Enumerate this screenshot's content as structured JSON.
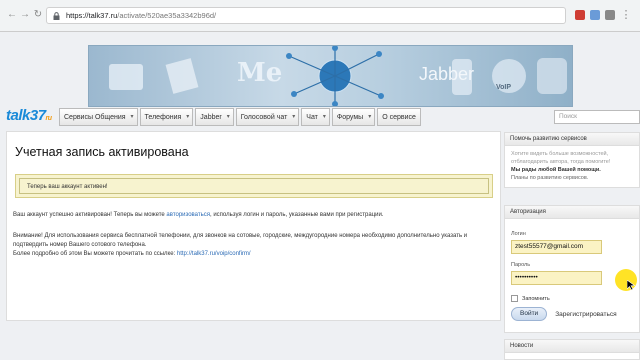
{
  "browser": {
    "url_host": "https://talk37.ru",
    "url_path": "/activate/520ae35a3342b96d/"
  },
  "logo": {
    "main": "talk37",
    "suffix": "ru"
  },
  "banner": {
    "jabber": "Jabber",
    "voip": "VoIP"
  },
  "menu": {
    "items": [
      "Сервисы Общения",
      "Телефония",
      "Jabber",
      "Голосовой чат",
      "Чат",
      "Форумы",
      "О сервисе"
    ]
  },
  "search": {
    "placeholder": "Поиск"
  },
  "main": {
    "title": "Учетная запись активирована",
    "notice": "Теперь ваш аккаунт активен!",
    "line1_pre": "Ваш аккаунт успешно активирован! Теперь вы можете ",
    "line1_link": "авторизоваться",
    "line1_post": ", используя логин и пароль, указанные вами при регистрации.",
    "warning": "Внимание! Для использования сервиса бесплатной телефонии, для звонков на сотовые, городские, междугородние номера необходимо дополнительно указать и подтвердить номер Вашего сотового телефона.",
    "more_pre": "Более подробно об этом Вы можете прочитать по ссылке: ",
    "more_link": "http://talk37.ru/voip/confirm/"
  },
  "help": {
    "header": "Помочь развитию сервисов",
    "text": "Хотите видеть больше возможностей, отблагодарить автора, тогда помогите!",
    "thanks": "Мы рады любой Вашей помощи.",
    "plans": "Планы по развитию сервисов."
  },
  "auth": {
    "header": "Авторизация",
    "login_label": "Логин",
    "login_value": "ztest55577@gmail.com",
    "password_label": "Пароль",
    "password_value": "••••••••••",
    "remember": "Запомнить",
    "login_button": "Войти",
    "register": "Зарегистрироваться"
  },
  "news": {
    "header": "Новости"
  },
  "colors": {
    "accent": "#1a8ad8",
    "notice_bg": "#f7f3cf",
    "input_bg": "#fbf3c4"
  }
}
